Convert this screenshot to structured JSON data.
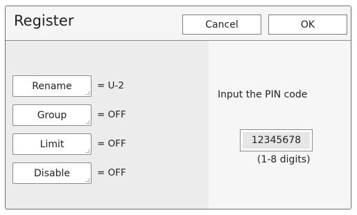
{
  "dialog": {
    "title": "Register",
    "buttons": {
      "cancel": "Cancel",
      "ok": "OK"
    }
  },
  "settings": [
    {
      "label": "Rename",
      "value": "= U-2"
    },
    {
      "label": "Group",
      "value": "= OFF"
    },
    {
      "label": "Limit",
      "value": "= OFF"
    },
    {
      "label": "Disable",
      "value": "= OFF"
    }
  ],
  "pin": {
    "label": "Input the PIN code",
    "value": "12345678",
    "hint": "(1-8 digits)"
  }
}
